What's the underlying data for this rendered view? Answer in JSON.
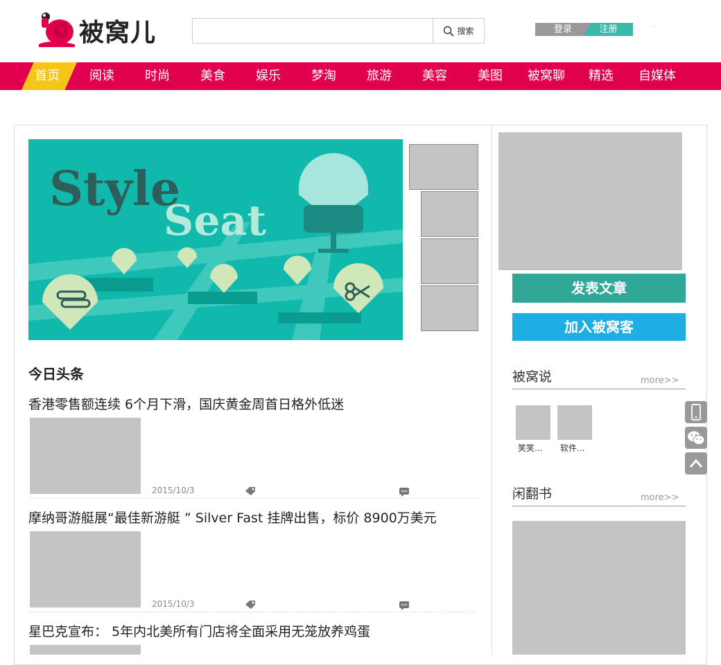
{
  "header": {
    "logo_text": "被窝儿",
    "search": {
      "value": "",
      "button_label": "搜索"
    },
    "login_label": "登录",
    "register_label": "注册"
  },
  "nav": {
    "items": [
      "首页",
      "阅读",
      "时尚",
      "美食",
      "娱乐",
      "梦淘",
      "旅游",
      "美容",
      "美图",
      "被窝聊",
      "精选",
      "自媒体"
    ],
    "active": "首页"
  },
  "banner": {
    "line1": "Style",
    "line2": "Seat"
  },
  "main": {
    "section_title": "今日头条",
    "articles": [
      {
        "title": "香港零售额连续 6个月下滑，国庆黄金周首日格外低迷",
        "date": "2015/10/3"
      },
      {
        "title": "摩纳哥游艇展“最佳新游艇 ” Silver Fast 挂牌出售，标价 8900万美元",
        "date": "2015/10/3"
      },
      {
        "title": "星巴克宣布： 5年内北美所有门店将全面采用无笼放养鸡蛋",
        "date": ""
      }
    ]
  },
  "sidebar": {
    "publish_label": "发表文章",
    "join_label": "加入被窝客",
    "section1": {
      "title": "被窝说",
      "more": "more>>",
      "items": [
        "笑笑...",
        "软件..."
      ]
    },
    "section2": {
      "title": "闲翻书",
      "more": "more>>"
    }
  },
  "colors": {
    "brand": "#e0004d",
    "nav_active": "#f5c518",
    "teal": "#31a797",
    "blue": "#1eaee3",
    "banner": "#10b9ad"
  },
  "icons": [
    "search-icon",
    "tag-icon",
    "comment-icon",
    "mobile-icon",
    "wechat-icon",
    "back-to-top-icon"
  ]
}
